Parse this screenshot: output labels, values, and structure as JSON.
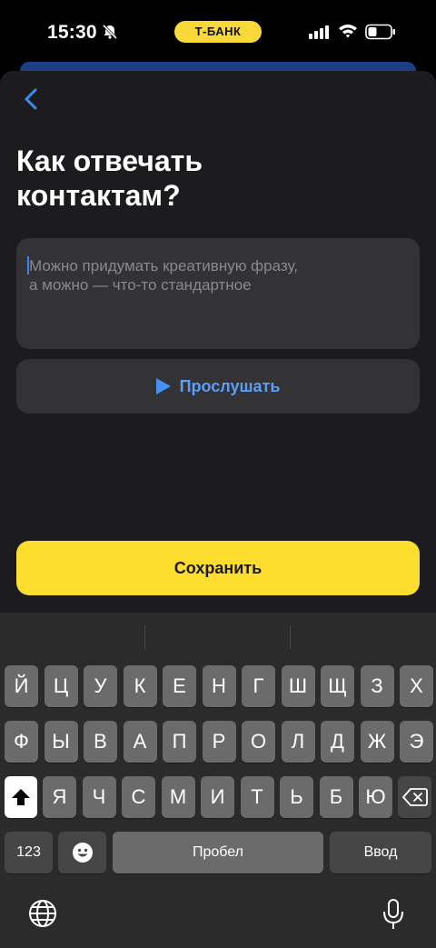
{
  "status_bar": {
    "time": "15:30",
    "carrier_label": "Т-БАНК",
    "icons": [
      "bell-off-icon",
      "signal-icon",
      "wifi-icon",
      "battery-icon"
    ]
  },
  "screen": {
    "back_icon": "chevron-left-icon",
    "title": "Как отвечать\nконтактам?",
    "text_area": {
      "value": "",
      "placeholder": "Можно придумать креативную фразу,\nа можно — что-то стандартное"
    },
    "listen_button": {
      "icon": "play-icon",
      "label": "Прослушать"
    },
    "save_button": {
      "label": "Сохранить"
    }
  },
  "keyboard": {
    "row1": [
      "Й",
      "Ц",
      "У",
      "К",
      "Е",
      "Н",
      "Г",
      "Ш",
      "Щ",
      "З",
      "Х"
    ],
    "row2": [
      "Ф",
      "Ы",
      "В",
      "А",
      "П",
      "Р",
      "О",
      "Л",
      "Д",
      "Ж",
      "Э"
    ],
    "row3": [
      "Я",
      "Ч",
      "С",
      "М",
      "И",
      "Т",
      "Ь",
      "Б",
      "Ю"
    ],
    "numbers_key": "123",
    "space_key": "Пробел",
    "return_key": "Ввод",
    "icons": [
      "shift-icon",
      "delete-icon",
      "emoji-icon",
      "globe-icon",
      "mic-icon"
    ]
  },
  "colors": {
    "accent_yellow": "#fddd2e",
    "link_blue": "#5b9ef7",
    "sheet_bg": "#1c1c1e",
    "field_bg": "#333336"
  }
}
